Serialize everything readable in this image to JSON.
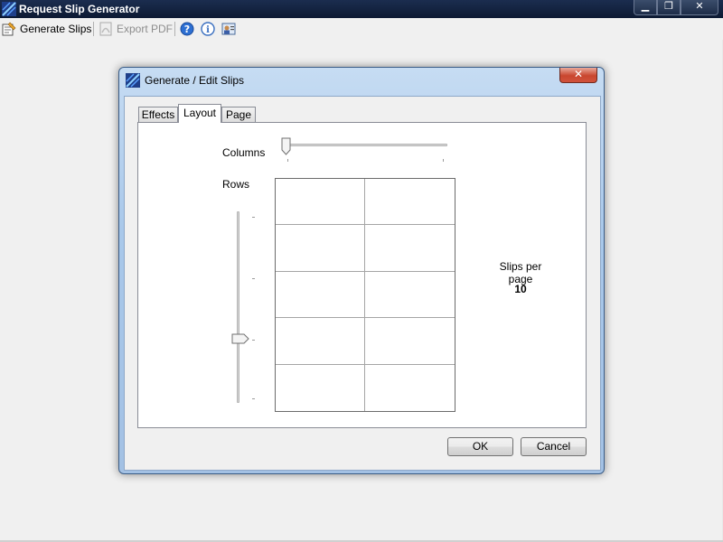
{
  "app": {
    "title": "Request Slip Generator"
  },
  "window_controls": {
    "minimize": "▁",
    "restore": "❐",
    "close": "✕"
  },
  "toolbar": {
    "generate_label": "Generate Slips",
    "export_label": "Export PDF"
  },
  "dialog": {
    "title": "Generate / Edit Slips",
    "close_glyph": "✕",
    "tabs": [
      {
        "label": "Effects"
      },
      {
        "label": "Layout"
      },
      {
        "label": "Page"
      }
    ],
    "active_tab": "Layout",
    "layout": {
      "columns_label": "Columns",
      "rows_label": "Rows",
      "columns_value": 2,
      "rows_value": 5,
      "slips_per_page_label": "Slips per page",
      "slips_per_page_value": "10"
    },
    "ok_label": "OK",
    "cancel_label": "Cancel"
  },
  "colors": {
    "titlebar": "#1b2d4f",
    "dialog_frame": "#a9c8ea",
    "close_red": "#c9462f"
  },
  "icons": [
    "app-icon",
    "generate-slips-icon",
    "pdf-icon",
    "help-icon",
    "info-icon",
    "about-icon",
    "dialog-icon"
  ]
}
